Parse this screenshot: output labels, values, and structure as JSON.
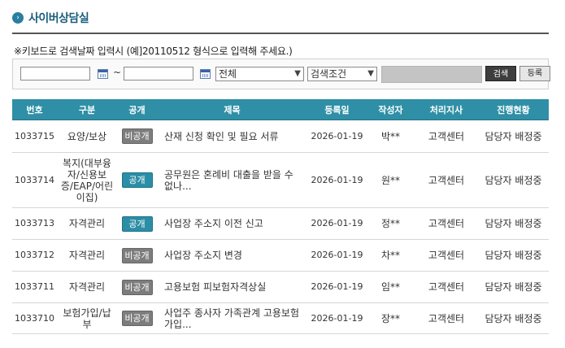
{
  "header": {
    "title": "사이버상담실",
    "icon": "arrow-circle-icon"
  },
  "search": {
    "hint": "※키보드로 검색날짜 입력시 (예]20110512 형식으로 입력해 주세요.)",
    "date_from": "",
    "date_to": "",
    "tilde": "~",
    "category_select": "전체",
    "condition_select": "검색조건",
    "keyword": "",
    "search_button": "검색",
    "register_button": "등록"
  },
  "table": {
    "headers": [
      "번호",
      "구분",
      "공개",
      "제목",
      "등록일",
      "작성자",
      "처리지사",
      "진행현황"
    ],
    "rows": [
      {
        "no": "1033715",
        "category": "요양/보상",
        "visibility": "비공개",
        "public": false,
        "subject": "산재 신청 확인 및 필요 서류",
        "date": "2026-01-19",
        "author": "박**",
        "branch": "고객센터",
        "status": "담당자 배정중"
      },
      {
        "no": "1033714",
        "category": "복지(대부융자/신용보증/EAP/어린이집)",
        "visibility": "공개",
        "public": true,
        "subject": "공무원은 혼례비 대출을 받을 수 없나...",
        "date": "2026-01-19",
        "author": "원**",
        "branch": "고객센터",
        "status": "담당자 배정중"
      },
      {
        "no": "1033713",
        "category": "자격관리",
        "visibility": "공개",
        "public": true,
        "subject": "사업장 주소지 이전 신고",
        "date": "2026-01-19",
        "author": "정**",
        "branch": "고객센터",
        "status": "담당자 배정중"
      },
      {
        "no": "1033712",
        "category": "자격관리",
        "visibility": "비공개",
        "public": false,
        "subject": "사업장 주소지 변경",
        "date": "2026-01-19",
        "author": "차**",
        "branch": "고객센터",
        "status": "담당자 배정중"
      },
      {
        "no": "1033711",
        "category": "자격관리",
        "visibility": "비공개",
        "public": false,
        "subject": "고용보험 피보험자격상실",
        "date": "2026-01-19",
        "author": "임**",
        "branch": "고객센터",
        "status": "담당자 배정중"
      },
      {
        "no": "1033710",
        "category": "보험가입/납부",
        "visibility": "비공개",
        "public": false,
        "subject": "사업주 종사자 가족관계 고용보험 가입...",
        "date": "2026-01-19",
        "author": "장**",
        "branch": "고객센터",
        "status": "담당자 배정중"
      }
    ]
  }
}
